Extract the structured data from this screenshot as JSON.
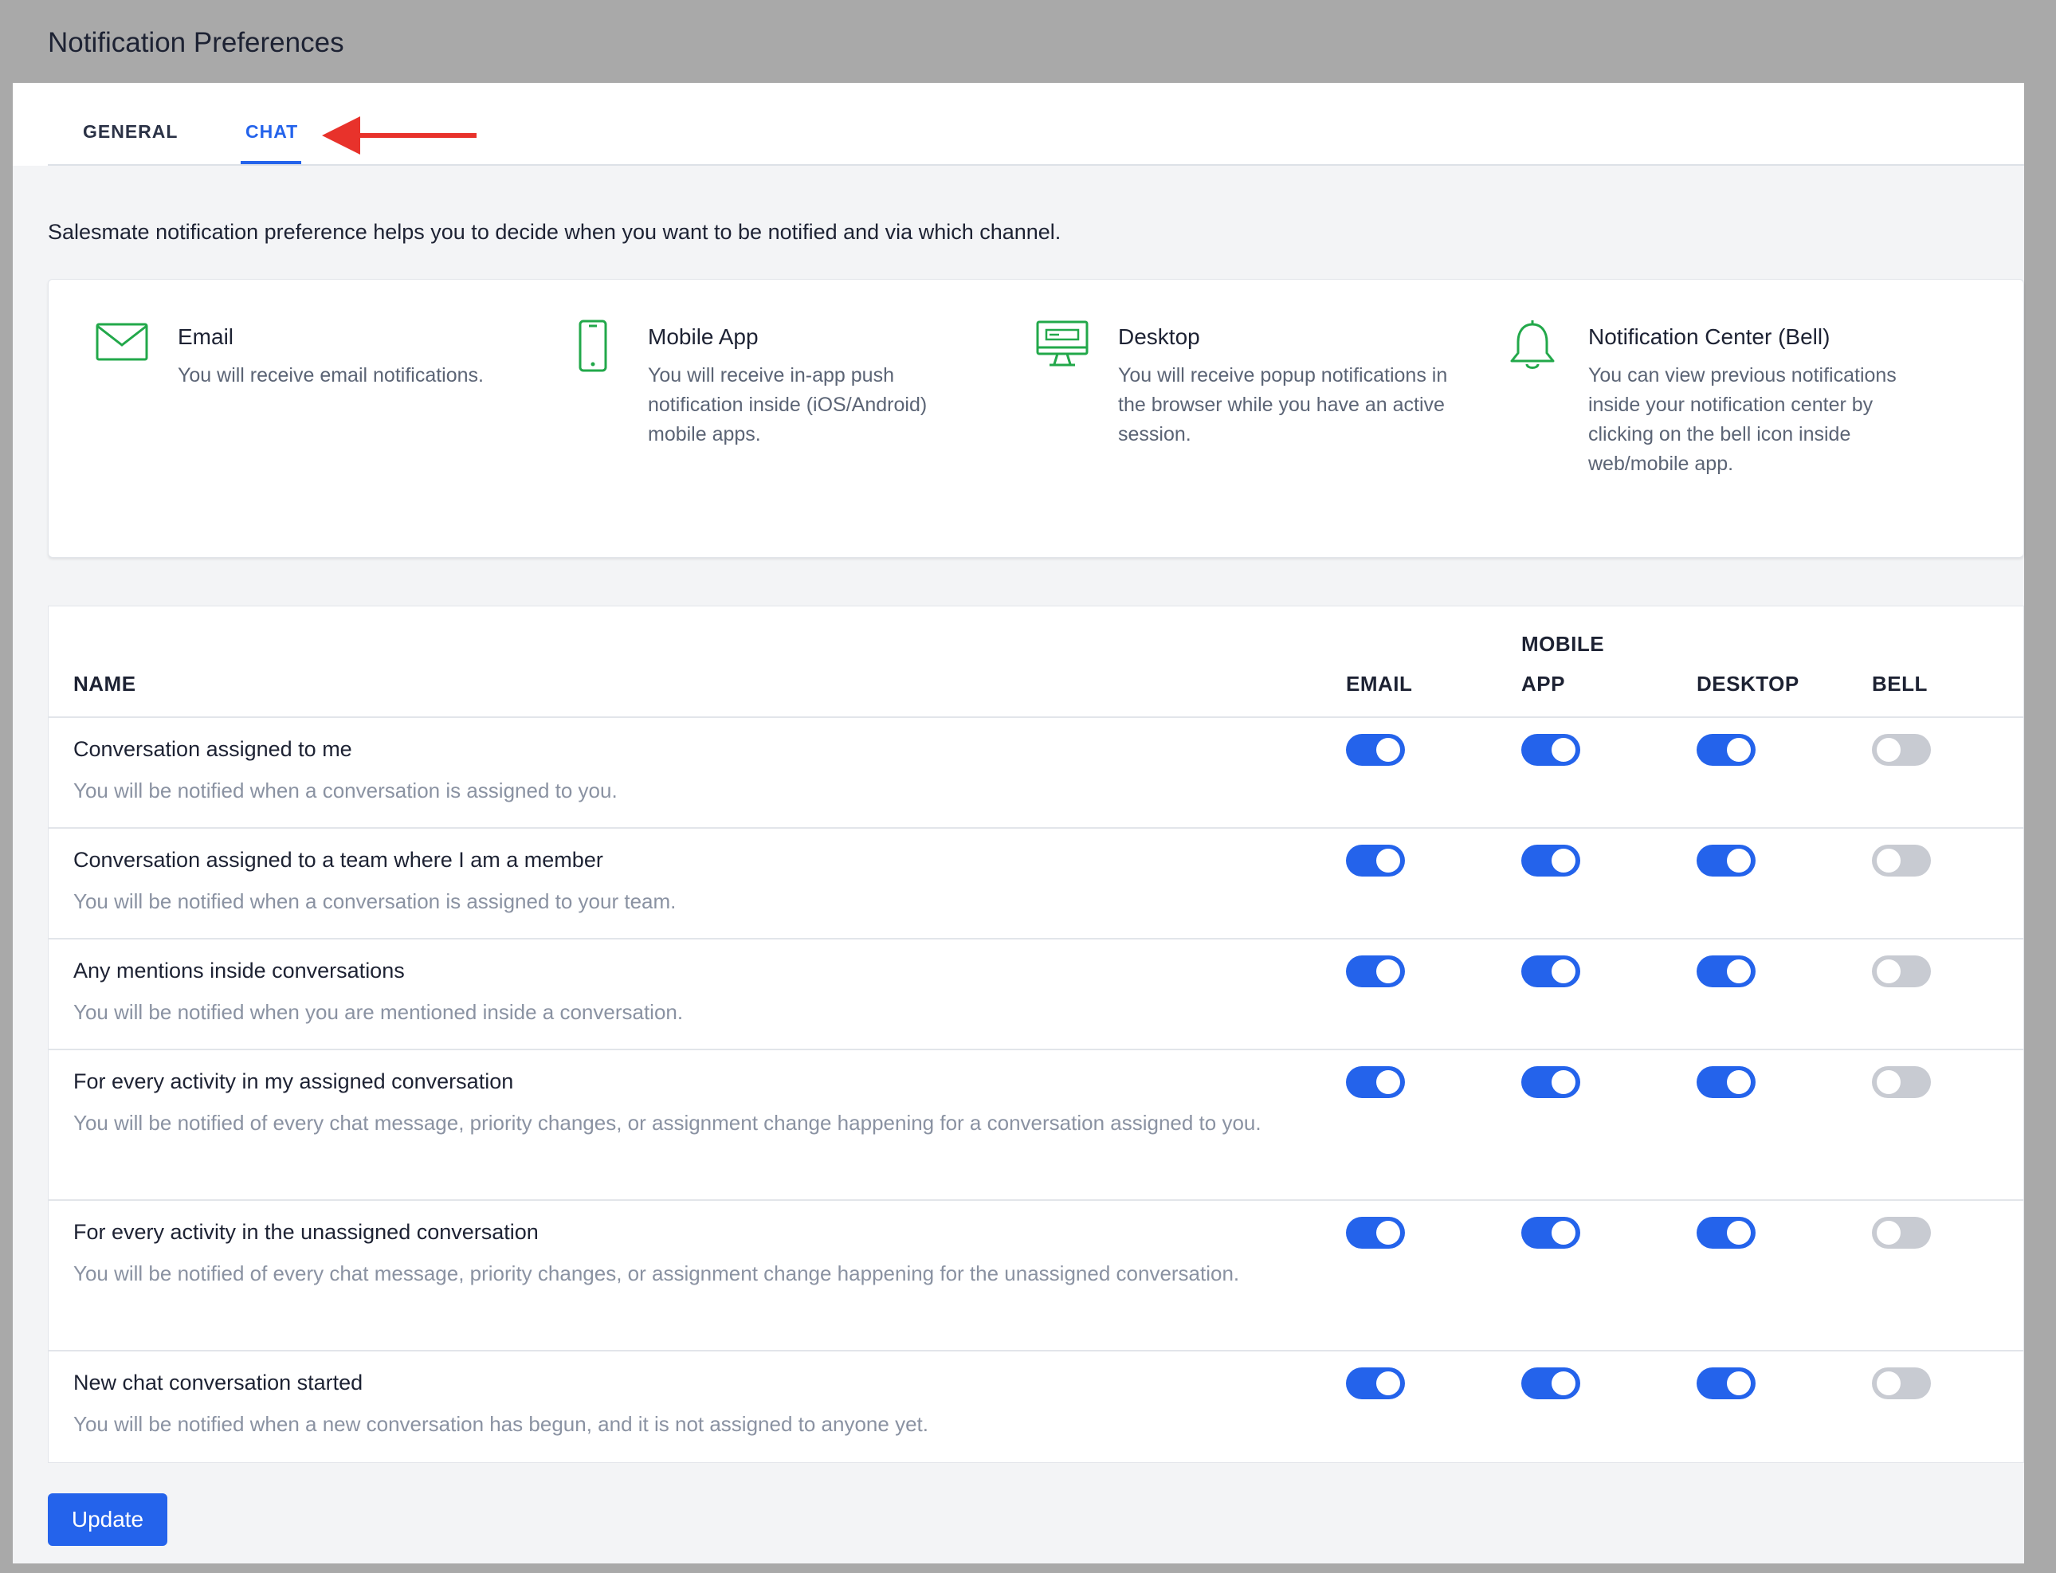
{
  "page": {
    "title": "Notification Preferences"
  },
  "tabs": [
    {
      "label": "GENERAL",
      "active": false
    },
    {
      "label": "CHAT",
      "active": true
    }
  ],
  "intro": "Salesmate notification preference helps you to decide when you want to be notified and via which channel.",
  "channels": [
    {
      "icon": "envelope-icon",
      "title": "Email",
      "desc": "You will receive email notifications."
    },
    {
      "icon": "mobile-phone-icon",
      "title": "Mobile App",
      "desc": "You will receive in-app push notification inside (iOS/Android) mobile apps."
    },
    {
      "icon": "desktop-monitor-icon",
      "title": "Desktop",
      "desc": "You will receive popup notifications in the browser while you have an active session."
    },
    {
      "icon": "bell-icon",
      "title": "Notification Center (Bell)",
      "desc": "You can view previous notifications inside your notification center by clicking on the bell icon inside web/mobile app."
    }
  ],
  "table": {
    "headers": {
      "name": "NAME",
      "email": "EMAIL",
      "mobile": "MOBILE APP",
      "desktop": "DESKTOP",
      "bell": "BELL"
    },
    "rows": [
      {
        "title": "Conversation assigned to me",
        "desc": "You will be notified when a conversation is assigned to you.",
        "email": true,
        "mobile": true,
        "desktop": true,
        "bell": false
      },
      {
        "title": "Conversation assigned to a team where I am a member",
        "desc": "You will be notified when a conversation is assigned to your team.",
        "email": true,
        "mobile": true,
        "desktop": true,
        "bell": false
      },
      {
        "title": "Any mentions inside conversations",
        "desc": "You will be notified when you are mentioned inside a conversation.",
        "email": true,
        "mobile": true,
        "desktop": true,
        "bell": false
      },
      {
        "title": "For every activity in my assigned conversation",
        "desc": "You will be notified of every chat message, priority changes, or assignment change happening for a conversation assigned to you.",
        "email": true,
        "mobile": true,
        "desktop": true,
        "bell": false
      },
      {
        "title": "For every activity in the unassigned conversation",
        "desc": "You will be notified of every chat message, priority changes, or assignment change happening for the unassigned conversation.",
        "email": true,
        "mobile": true,
        "desktop": true,
        "bell": false
      },
      {
        "title": "New chat conversation started",
        "desc": "You will be notified when a new conversation has begun, and it is not assigned to anyone yet.",
        "email": true,
        "mobile": true,
        "desktop": true,
        "bell": false
      }
    ]
  },
  "update_label": "Update",
  "colors": {
    "accent": "#2463eb",
    "icon_green": "#22a84a",
    "annotation_red": "#e8322b",
    "toggle_off": "#c8cbd2"
  }
}
